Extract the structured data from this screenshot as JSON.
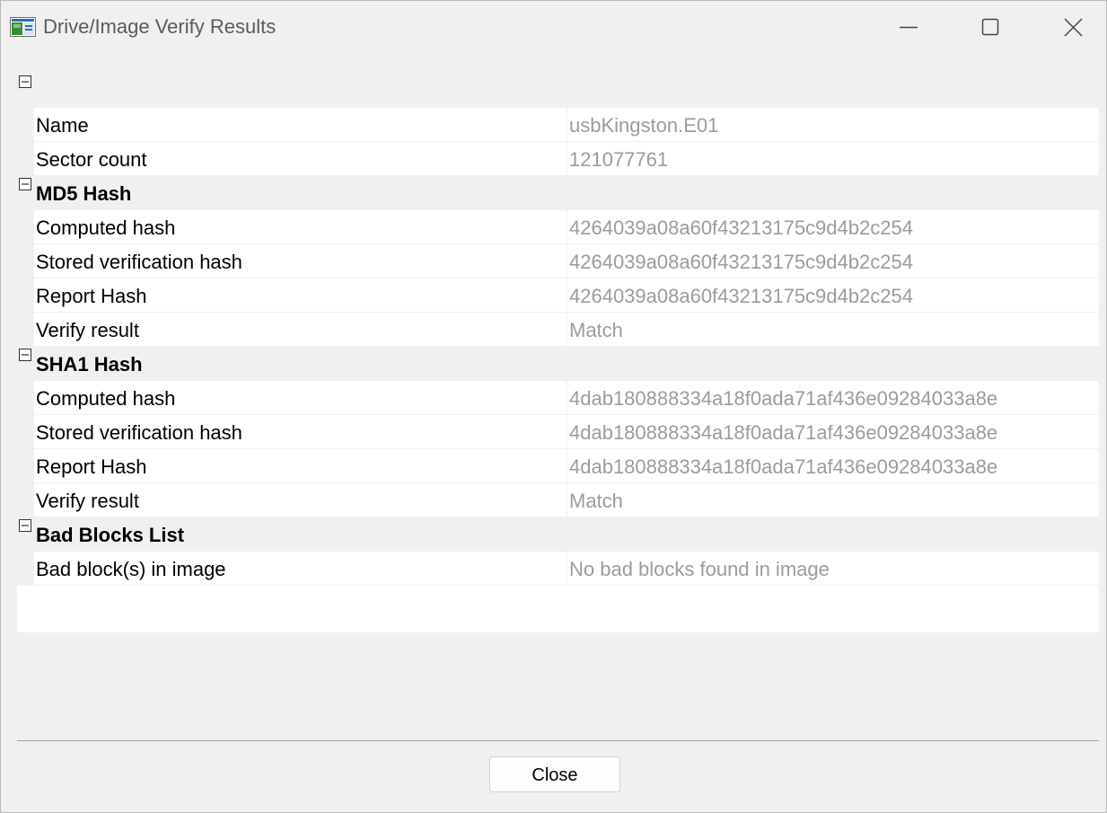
{
  "window": {
    "title": "Drive/Image Verify Results",
    "icon": "drive-image-app-icon",
    "controls": [
      "minimize-icon",
      "maximize-icon",
      "close-icon"
    ]
  },
  "groups": {
    "general": {
      "title": "",
      "rows": [
        {
          "label": "Name",
          "value": "usbKingston.E01"
        },
        {
          "label": "Sector count",
          "value": "121077761"
        }
      ]
    },
    "md5": {
      "title": "MD5 Hash",
      "rows": [
        {
          "label": "Computed hash",
          "value": "4264039a08a60f43213175c9d4b2c254"
        },
        {
          "label": "Stored verification hash",
          "value": "4264039a08a60f43213175c9d4b2c254"
        },
        {
          "label": "Report Hash",
          "value": "4264039a08a60f43213175c9d4b2c254"
        },
        {
          "label": "Verify result",
          "value": "Match"
        }
      ]
    },
    "sha1": {
      "title": "SHA1 Hash",
      "rows": [
        {
          "label": "Computed hash",
          "value": "4dab180888334a18f0ada71af436e09284033a8e"
        },
        {
          "label": "Stored verification hash",
          "value": "4dab180888334a18f0ada71af436e09284033a8e"
        },
        {
          "label": "Report Hash",
          "value": "4dab180888334a18f0ada71af436e09284033a8e"
        },
        {
          "label": "Verify result",
          "value": "Match"
        }
      ]
    },
    "bad_blocks": {
      "title": "Bad Blocks List",
      "rows": [
        {
          "label": "Bad block(s) in image",
          "value": "No bad blocks found in image"
        }
      ]
    }
  },
  "footer": {
    "close_label": "Close"
  },
  "colors": {
    "background": "#f0f0f0",
    "grid_background": "#ffffff",
    "value_text": "#9c9c9c",
    "label_text": "#000000"
  }
}
